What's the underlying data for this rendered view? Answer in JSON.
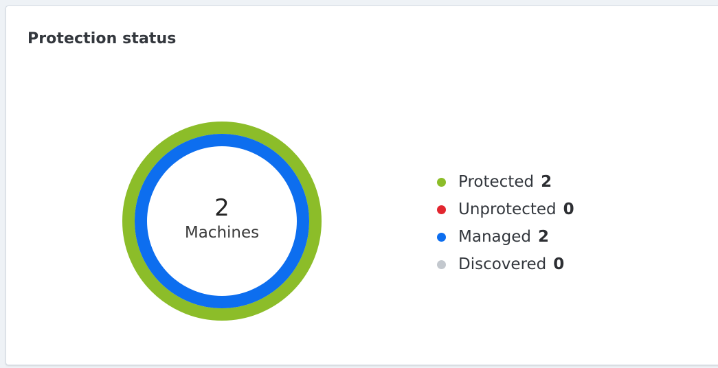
{
  "widget": {
    "title": "Protection status"
  },
  "donut": {
    "total_value": "2",
    "total_label": "Machines",
    "rings": [
      {
        "name": "Protected",
        "value": 2,
        "total": 2,
        "color": "#8cbd29"
      },
      {
        "name": "Managed",
        "value": 2,
        "total": 2,
        "color": "#0d6eef"
      }
    ]
  },
  "legend": {
    "items": [
      {
        "label": "Protected",
        "count": "2",
        "color": "#8cbd29"
      },
      {
        "label": "Unprotected",
        "count": "0",
        "color": "#e2262f"
      },
      {
        "label": "Managed",
        "count": "2",
        "color": "#0d6eef"
      },
      {
        "label": "Discovered",
        "count": "0",
        "color": "#c3c8ce"
      }
    ]
  }
}
